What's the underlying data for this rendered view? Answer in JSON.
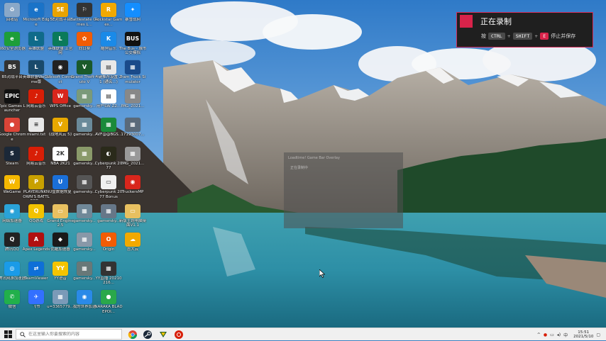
{
  "desktop": {
    "icons": [
      {
        "label": "回收站",
        "icon": "recycle-bin-icon",
        "color": "#8aa8c8",
        "glyph": "♻"
      },
      {
        "label": "360安全浏览器",
        "icon": "browser-icon",
        "color": "#1d9e3a",
        "glyph": "e"
      },
      {
        "label": "B5对战平台",
        "icon": "game-platform-icon",
        "color": "#333333",
        "glyph": "B5"
      },
      {
        "label": "Epic Games Launcher",
        "icon": "epic-games-icon",
        "color": "#111111",
        "glyph": "EPIC"
      },
      {
        "label": "Google Chrome",
        "icon": "chrome-icon",
        "color": "#db4437",
        "glyph": "●"
      },
      {
        "label": "Steam",
        "icon": "steam-icon",
        "color": "#1b2838",
        "glyph": "S"
      },
      {
        "label": "WeGame",
        "icon": "wegame-icon",
        "color": "#f5b800",
        "glyph": "W"
      },
      {
        "label": "网络加速器",
        "icon": "accelerator-icon",
        "color": "#2aa3d8",
        "glyph": "◉"
      },
      {
        "label": "腾讯QQ",
        "icon": "qq-icon",
        "color": "#222222",
        "glyph": "Q"
      },
      {
        "label": "腾讯网游加速器",
        "icon": "game-accelerator-icon",
        "color": "#1a9be8",
        "glyph": "◎"
      },
      {
        "label": "微信",
        "icon": "wechat-icon",
        "color": "#21b04b",
        "glyph": "✆"
      },
      {
        "label": "Microsoft Edge",
        "icon": "edge-icon",
        "color": "#1a73c8",
        "glyph": "e"
      },
      {
        "label": "英雄联盟",
        "icon": "league-icon",
        "color": "#0f6b8a",
        "glyph": "L"
      },
      {
        "label": "英雄联盟WeGame版",
        "icon": "league-wegame-icon",
        "color": "#1a4a6b",
        "glyph": "L"
      },
      {
        "label": "网易云音乐",
        "icon": "netease-music-icon",
        "color": "#d81e06",
        "glyph": "♪"
      },
      {
        "label": "miami.txt",
        "icon": "text-file-icon",
        "color": "#e8e8e8",
        "glyph": "≡"
      },
      {
        "label": "网易云音乐",
        "icon": "netease-music-icon",
        "color": "#d81e06",
        "glyph": "♪"
      },
      {
        "label": "PLAYERUNKNOWN'S BATTLEGR...",
        "icon": "pubg-icon",
        "color": "#c8a000",
        "glyph": "P"
      },
      {
        "label": "QQ游戏",
        "icon": "qq-game-icon",
        "color": "#f2c200",
        "glyph": "Q"
      },
      {
        "label": "Apex Legends",
        "icon": "apex-icon",
        "color": "#b01010",
        "glyph": "A"
      },
      {
        "label": "TeamViewer",
        "icon": "teamviewer-icon",
        "color": "#0e6fd8",
        "glyph": "⇄"
      },
      {
        "label": "飞书",
        "icon": "feishu-icon",
        "color": "#3370ff",
        "glyph": "✈"
      },
      {
        "label": "5E对战平台",
        "icon": "5e-platform-icon",
        "color": "#e8a300",
        "glyph": "5E"
      },
      {
        "label": "英雄联盟 上官网",
        "icon": "league-site-icon",
        "color": "#0a7a5a",
        "glyph": "L"
      },
      {
        "label": "Ubisoft Connect",
        "icon": "ubisoft-icon",
        "color": "#222222",
        "glyph": "◉"
      },
      {
        "label": "WPS Office",
        "icon": "wps-icon",
        "color": "#d8261c",
        "glyph": "W"
      },
      {
        "label": "《战地风云 5》",
        "icon": "battlefield-icon",
        "color": "#e8a800",
        "glyph": "V"
      },
      {
        "label": "NBA 2K21",
        "icon": "nba-icon",
        "color": "#ffffff",
        "glyph": "2K"
      },
      {
        "label": "U盘数据恢复",
        "icon": "usb-recovery-icon",
        "color": "#1a6fd8",
        "glyph": "U"
      },
      {
        "label": "Grand Engine 2.5",
        "icon": "folder-icon",
        "color": "#e8c060",
        "glyph": "▭"
      },
      {
        "label": "优酷加速器",
        "icon": "youku-icon",
        "color": "#1a1a1a",
        "glyph": "◆"
      },
      {
        "label": "YY语音",
        "icon": "yy-icon",
        "color": "#f5c400",
        "glyph": "YY"
      },
      {
        "label": "u=3365779...",
        "icon": "image-file-icon",
        "color": "#7a9ab8",
        "glyph": "▦"
      },
      {
        "label": "Battlestate Games L...",
        "icon": "battlestate-icon",
        "color": "#333333",
        "glyph": "⚐"
      },
      {
        "label": "向日葵",
        "icon": "sunflower-icon",
        "color": "#f25c05",
        "glyph": "✿"
      },
      {
        "label": "Grand Theft Auto V",
        "icon": "gta-icon",
        "color": "#1a5a2a",
        "glyph": "V"
      },
      {
        "label": "gamersky...",
        "icon": "image-file-icon",
        "color": "#7a9a7a",
        "glyph": "▦"
      },
      {
        "label": "gamersky...",
        "icon": "image-file-icon",
        "color": "#6a8a9a",
        "glyph": "▦"
      },
      {
        "label": "gamersky...",
        "icon": "image-file-icon",
        "color": "#8a9a6a",
        "glyph": "▦"
      },
      {
        "label": "gamersky...",
        "icon": "image-file-icon",
        "color": "#555555",
        "glyph": "▦"
      },
      {
        "label": "gamersky...",
        "icon": "image-file-icon",
        "color": "#708898",
        "glyph": "▦"
      },
      {
        "label": "gamersky...",
        "icon": "image-file-icon",
        "color": "#8898a8",
        "glyph": "▦"
      },
      {
        "label": "gamersky...",
        "icon": "image-file-icon",
        "color": "#687878",
        "glyph": "▦"
      },
      {
        "label": "我的世界加速",
        "icon": "minecraft-icon",
        "color": "#2a8ae8",
        "glyph": "◉"
      },
      {
        "label": "Rockstar Games...",
        "icon": "rockstar-icon",
        "color": "#f2a900",
        "glyph": "R"
      },
      {
        "label": "酷狗音乐",
        "icon": "kugou-icon",
        "color": "#1a8ae8",
        "glyph": "K"
      },
      {
        "label": "一键推荐设置 2.1 (通名...)",
        "icon": "settings-file-icon",
        "color": "#e8e8e8",
        "glyph": "▤"
      },
      {
        "label": "用户SW Z2...",
        "icon": "document-icon",
        "color": "#ffffff",
        "glyph": "▤"
      },
      {
        "label": "AVF@@BGS...",
        "icon": "green-app-icon",
        "color": "#1a8a3a",
        "glyph": "▦"
      },
      {
        "label": "Cyberpunk 2077",
        "icon": "cyberpunk-icon",
        "color": "#2a2a1a",
        "glyph": "◐"
      },
      {
        "label": "Cyberpunk 2077 Bonus",
        "icon": "cyberpunk-bonus-icon",
        "color": "#f0f0f0",
        "glyph": "▭"
      },
      {
        "label": "gamersky...",
        "icon": "image-file-icon",
        "color": "#667788",
        "glyph": "▦"
      },
      {
        "label": "Origin",
        "icon": "origin-icon",
        "color": "#f25c05",
        "glyph": "O"
      },
      {
        "label": "YY直播 20210216...",
        "icon": "yy-live-icon",
        "color": "#333333",
        "glyph": "▦"
      },
      {
        "label": "NARAKA BLADEPOI...",
        "icon": "naraka-icon",
        "color": "#2aa84a",
        "glyph": "●"
      },
      {
        "label": "暴雪战网",
        "icon": "battlenet-icon",
        "color": "#148eff",
        "glyph": "✦"
      },
      {
        "label": "The Bus - 城市公交模拟",
        "icon": "the-bus-icon",
        "color": "#111111",
        "glyph": "BUS"
      },
      {
        "label": "Tram Truck Simulator",
        "icon": "tram-icon",
        "color": "#1a4a8a",
        "glyph": "▦"
      },
      {
        "label": "IMG_2021...",
        "icon": "image-file-icon",
        "color": "#888888",
        "glyph": "▦"
      },
      {
        "label": "17193007...",
        "icon": "image-file-icon",
        "color": "#5a6a7a",
        "glyph": "▦"
      },
      {
        "label": "IMG_2021...",
        "icon": "image-file-icon",
        "color": "#999999",
        "glyph": "▦"
      },
      {
        "label": "TruckersMP",
        "icon": "truckersmp-icon",
        "color": "#d8261c",
        "glyph": "◉"
      },
      {
        "label": "新版主题电脑桌面V1.1",
        "icon": "folder-icon",
        "color": "#e8c060",
        "glyph": "▭"
      },
      {
        "label": "吉大云",
        "icon": "cloud-icon",
        "color": "#f2a900",
        "glyph": "☁"
      }
    ]
  },
  "recording": {
    "title": "正在录制",
    "press": "按",
    "key1": "CTRL",
    "key2": "SHIFT",
    "key3": "E",
    "action": "停止并保存"
  },
  "ghost_window": {
    "title": "Loadtime! Game Bar Overlay",
    "text": "正在录制中"
  },
  "taskbar": {
    "search_placeholder": "在这里输入你要搜索的内容",
    "time": "15:51",
    "date": "2021/5/10",
    "ime": "中"
  },
  "colors": {
    "accent": "#d8234a",
    "taskbar": "#f0f0f0"
  }
}
